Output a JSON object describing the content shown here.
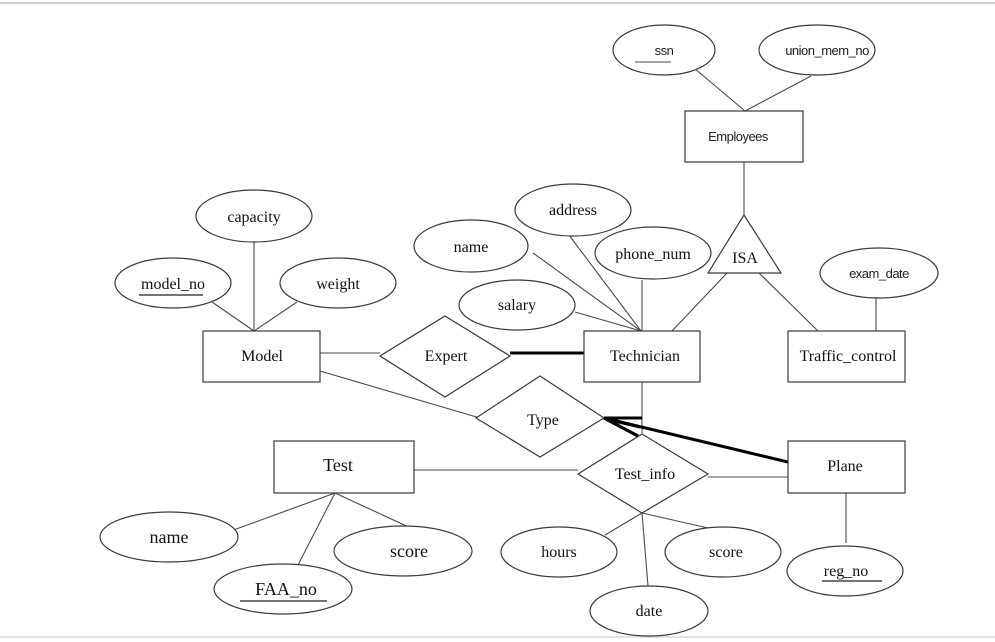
{
  "diagram": {
    "type": "ER diagram",
    "entities": [
      {
        "id": "employees",
        "label": "Employees"
      },
      {
        "id": "technician",
        "label": "Technician"
      },
      {
        "id": "traffic_control",
        "label": "Traffic_control"
      },
      {
        "id": "model",
        "label": "Model"
      },
      {
        "id": "test",
        "label": "Test"
      },
      {
        "id": "plane",
        "label": "Plane"
      }
    ],
    "relationships": [
      {
        "id": "expert",
        "label": "Expert",
        "connects": [
          "model",
          "technician"
        ]
      },
      {
        "id": "type",
        "label": "Type",
        "connects": [
          "model",
          "plane"
        ]
      },
      {
        "id": "test_info",
        "label": "Test_info",
        "connects": [
          "test",
          "technician",
          "plane"
        ]
      }
    ],
    "isa": {
      "id": "isa",
      "label": "ISA",
      "parent": "employees",
      "children": [
        "technician",
        "traffic_control"
      ]
    },
    "attributes": {
      "ssn": {
        "label": "ssn",
        "owner": "employees",
        "key": true
      },
      "union_mem_no": {
        "label": "union_mem_no",
        "owner": "employees",
        "key": false
      },
      "capacity": {
        "label": "capacity",
        "owner": "model",
        "key": false
      },
      "model_no": {
        "label": "model_no",
        "owner": "model",
        "key": true
      },
      "weight": {
        "label": "weight",
        "owner": "model",
        "key": false
      },
      "address": {
        "label": "address",
        "owner": "technician",
        "key": false
      },
      "tech_name": {
        "label": "name",
        "owner": "technician",
        "key": false
      },
      "phone_num": {
        "label": "phone_num",
        "owner": "technician",
        "key": false
      },
      "salary": {
        "label": "salary",
        "owner": "technician",
        "key": false
      },
      "exam_date": {
        "label": "exam_date",
        "owner": "traffic_control",
        "key": false
      },
      "test_name": {
        "label": "name",
        "owner": "test",
        "key": false
      },
      "faa_no": {
        "label": "FAA_no",
        "owner": "test",
        "key": true
      },
      "test_score": {
        "label": "score",
        "owner": "test",
        "key": false
      },
      "hours": {
        "label": "hours",
        "owner": "test_info",
        "key": false
      },
      "date": {
        "label": "date",
        "owner": "test_info",
        "key": false
      },
      "info_score": {
        "label": "score",
        "owner": "test_info",
        "key": false
      },
      "reg_no": {
        "label": "reg_no",
        "owner": "plane",
        "key": true
      }
    },
    "participation": {
      "bold_edges": [
        "expert-technician",
        "type-plane",
        "test_info-type"
      ]
    }
  }
}
